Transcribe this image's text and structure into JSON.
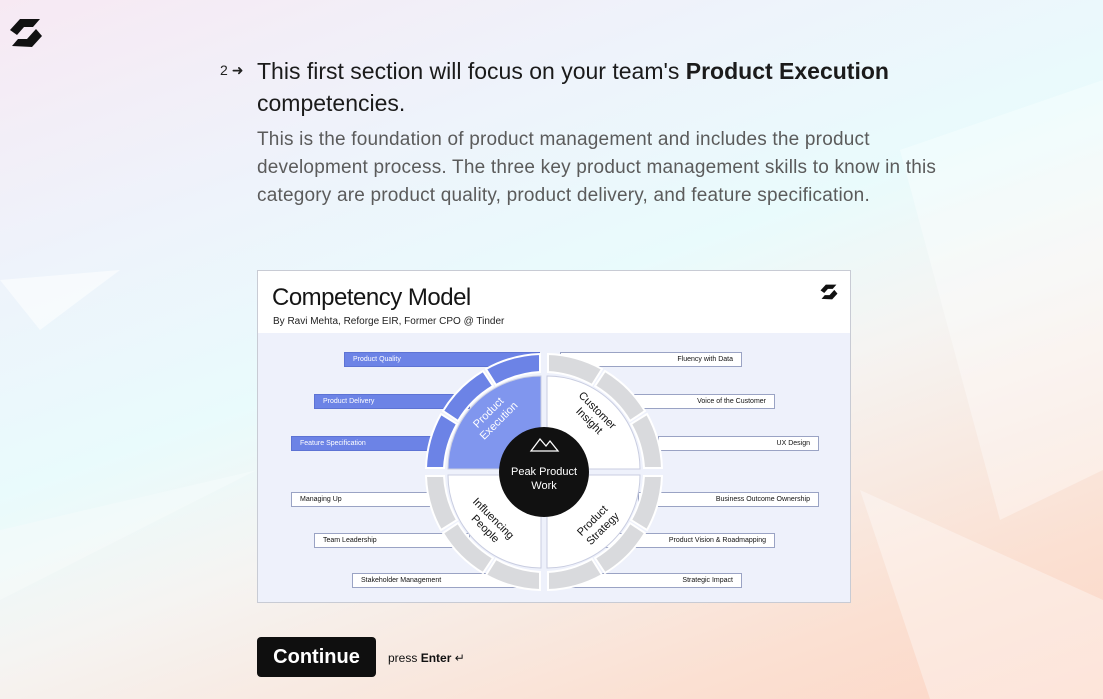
{
  "question": {
    "number": "2",
    "title_pre": "This first section will focus on your team's ",
    "title_bold": "Product Execution",
    "title_post": "competencies.",
    "description": "This is the foundation of product management and includes the product development process. The three key product management skills to know in this category are product quality, product delivery, and feature specification."
  },
  "figure": {
    "title": "Competency Model",
    "subtitle": "By Ravi Mehta, Reforge EIR, Former CPO @ Tinder",
    "center_line1": "Peak Product",
    "center_line2": "Work",
    "quadrants": {
      "top_left": [
        "Product",
        "Execution"
      ],
      "top_right": [
        "Customer",
        "Insight"
      ],
      "bottom_left": [
        "Influencing",
        "People"
      ],
      "bottom_right": [
        "Product",
        "Strategy"
      ]
    },
    "labels": {
      "product_quality": "Product Quality",
      "product_delivery": "Product Delivery",
      "feature_specification": "Feature Specification",
      "fluency_with_data": "Fluency with Data",
      "voice_of_customer": "Voice of the Customer",
      "ux_design": "UX Design",
      "managing_up": "Managing Up",
      "team_leadership": "Team Leadership",
      "stakeholder_management": "Stakeholder Management",
      "business_outcome": "Business Outcome Ownership",
      "product_vision": "Product Vision & Roadmapping",
      "strategic_impact": "Strategic Impact"
    },
    "colors": {
      "accent": "#6c83e6",
      "segment_gray": "#d9dadd",
      "center": "#111111"
    }
  },
  "actions": {
    "continue_label": "Continue",
    "press_text": "press",
    "press_key": "Enter",
    "enter_symbol": "↵"
  },
  "icons": {
    "brand": "reforge-logo-icon",
    "arrow": "arrow-right-icon",
    "mountain": "mountain-icon"
  }
}
